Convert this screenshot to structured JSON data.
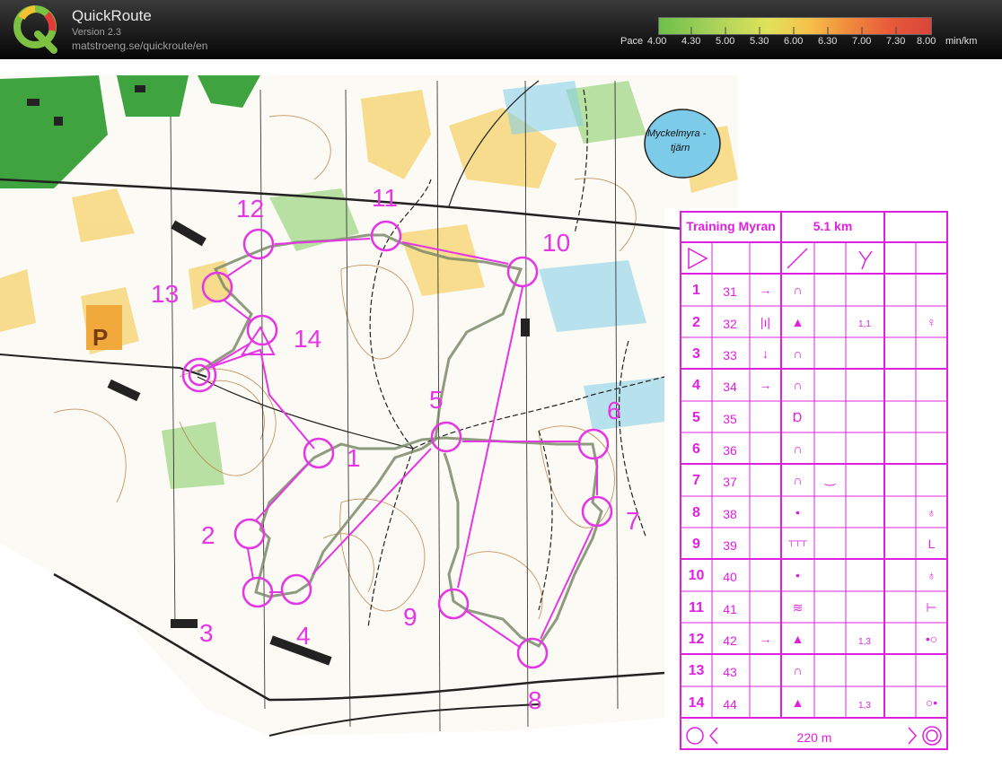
{
  "app": {
    "title": "QuickRoute",
    "version": "Version 2.3",
    "url": "matstroeng.se/quickroute/en",
    "logo_letter": "Q"
  },
  "pace_legend": {
    "label": "Pace",
    "values": [
      "4.00",
      "4.30",
      "5.00",
      "5.30",
      "6.00",
      "6.30",
      "7.00",
      "7.30",
      "8.00"
    ],
    "unit": "min/km",
    "colors": [
      "#6dbf4a",
      "#e0e25a",
      "#f08a3c",
      "#d9453a"
    ]
  },
  "map": {
    "lake_name": [
      "Myckelmyra -",
      "tjärn"
    ],
    "parking": "P",
    "control_labels": [
      "1",
      "2",
      "3",
      "4",
      "5",
      "6",
      "7",
      "8",
      "9",
      "10",
      "11",
      "12",
      "13",
      "14"
    ],
    "course_color": "#e535e5",
    "route_color": "#7a8a6a"
  },
  "control_description": {
    "title": "Training Myran",
    "distance": "5.1 km",
    "rows": [
      {
        "num": "1",
        "code": "31",
        "c": "→",
        "d": "∩",
        "g": "",
        "h": ""
      },
      {
        "num": "2",
        "code": "32",
        "c": "|ı|",
        "d": "▲",
        "g": "1,1",
        "h": "♀"
      },
      {
        "num": "3",
        "code": "33",
        "c": "↓",
        "d": "∩",
        "g": "",
        "h": ""
      },
      {
        "num": "4",
        "code": "34",
        "c": "→",
        "d": "∩",
        "g": "",
        "h": ""
      },
      {
        "num": "5",
        "code": "35",
        "c": "",
        "d": "Ɒ",
        "g": "",
        "h": ""
      },
      {
        "num": "6",
        "code": "36",
        "c": "",
        "d": "∩",
        "g": "",
        "h": ""
      },
      {
        "num": "7",
        "code": "37",
        "c": "",
        "d": "∩",
        "e": "‿",
        "g": "",
        "h": ""
      },
      {
        "num": "8",
        "code": "38",
        "c": "",
        "d": "•",
        "g": "",
        "h": "♁"
      },
      {
        "num": "9",
        "code": "39",
        "c": "",
        "d": "┬┬┬",
        "g": "",
        "h": "L"
      },
      {
        "num": "10",
        "code": "40",
        "c": "",
        "d": "•",
        "g": "",
        "h": "♁"
      },
      {
        "num": "11",
        "code": "41",
        "c": "",
        "d": "≋",
        "g": "",
        "h": "⊢"
      },
      {
        "num": "12",
        "code": "42",
        "c": "→",
        "d": "▲",
        "g": "1,3",
        "h": "•○"
      },
      {
        "num": "13",
        "code": "43",
        "c": "",
        "d": "∩",
        "g": "",
        "h": ""
      },
      {
        "num": "14",
        "code": "44",
        "c": "",
        "d": "▲",
        "g": "1,3",
        "h": "○•"
      }
    ],
    "finish_distance": "220 m"
  }
}
